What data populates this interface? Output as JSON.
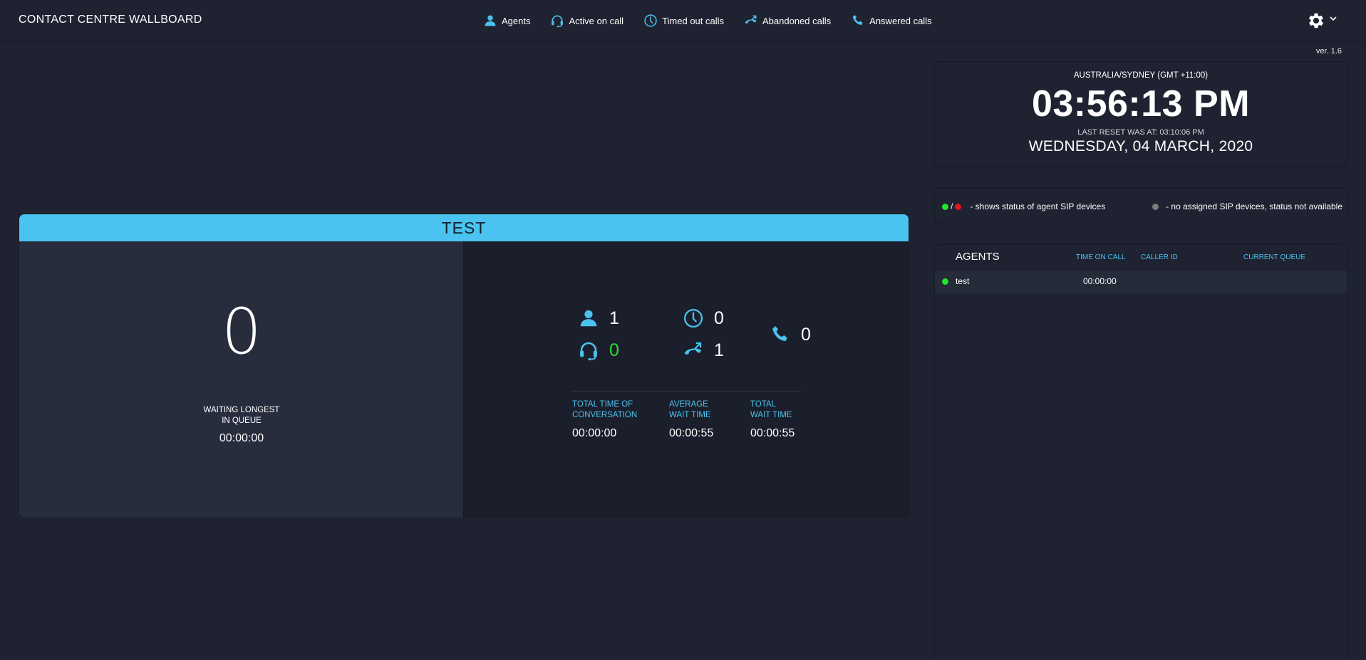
{
  "header": {
    "title": "CONTACT CENTRE WALLBOARD",
    "legend": [
      {
        "label": "Agents",
        "icon": "person-icon"
      },
      {
        "label": "Active on call",
        "icon": "headset-icon"
      },
      {
        "label": "Timed out calls",
        "icon": "clock-icon"
      },
      {
        "label": "Abandoned calls",
        "icon": "hangup-phone-icon"
      },
      {
        "label": "Answered calls",
        "icon": "phone-icon"
      }
    ],
    "settings_icon": "gear-icon"
  },
  "version": "ver. 1.6",
  "colors": {
    "accent": "#4ac3f0",
    "background": "#1f2331",
    "panel_left": "#282d3e",
    "status_green": "#20e52a",
    "status_red": "#e0161b",
    "status_grey": "#7b7b7b"
  },
  "queue": {
    "name": "TEST",
    "waiting_count": "0",
    "waiting_label_line1": "WAITING LONGEST",
    "waiting_label_line2": "IN QUEUE",
    "waiting_longest": "00:00:00",
    "stats": {
      "agents": "1",
      "active_on_call": "0",
      "timed_out": "0",
      "abandoned": "1",
      "answered": "0"
    },
    "metrics": [
      {
        "label_line1": "TOTAL TIME OF",
        "label_line2": "CONVERSATION",
        "value": "00:00:00"
      },
      {
        "label_line1": "AVERAGE",
        "label_line2": "WAIT TIME",
        "value": "00:00:55"
      },
      {
        "label_line1": "TOTAL",
        "label_line2": "WAIT TIME",
        "value": "00:00:55"
      }
    ]
  },
  "clock": {
    "timezone": "AUSTRALIA/SYDNEY (GMT +11:00)",
    "time": "03:56:13 PM",
    "last_reset": "LAST RESET WAS AT: 03:10:06 PM",
    "date": "WEDNESDAY, 04 MARCH, 2020"
  },
  "status_legend": {
    "slash": "/",
    "sip_status": "- shows status of agent SIP devices",
    "no_sip": "- no assigned SIP devices, status not available"
  },
  "agents": {
    "title": "AGENTS",
    "columns": [
      "TIME ON CALL",
      "CALLER ID",
      "CURRENT QUEUE"
    ],
    "rows": [
      {
        "status": "online",
        "name": "test",
        "time_on_call": "00:00:00",
        "caller_id": "",
        "current_queue": ""
      }
    ]
  }
}
